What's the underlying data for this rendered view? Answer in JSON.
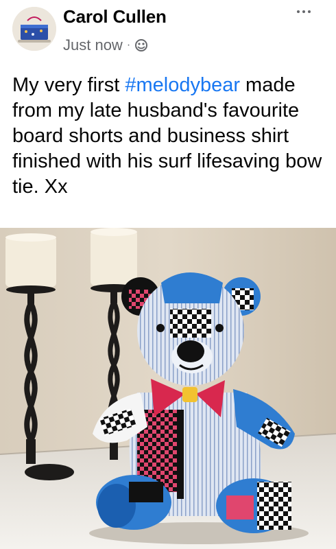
{
  "post": {
    "author": "Carol Cullen",
    "timestamp": "Just now",
    "separator": "·",
    "privacy_icon": "globe-icon",
    "more_icon": "more-options-icon",
    "text_before": "My very first ",
    "hashtag": "#melodybear",
    "text_after": " made from my late husband's favourite board shorts and business shirt finished with his surf lifesaving bow tie. Xx"
  },
  "colors": {
    "hashtag": "#1877f2",
    "meta": "#65676b",
    "text": "#050505"
  }
}
